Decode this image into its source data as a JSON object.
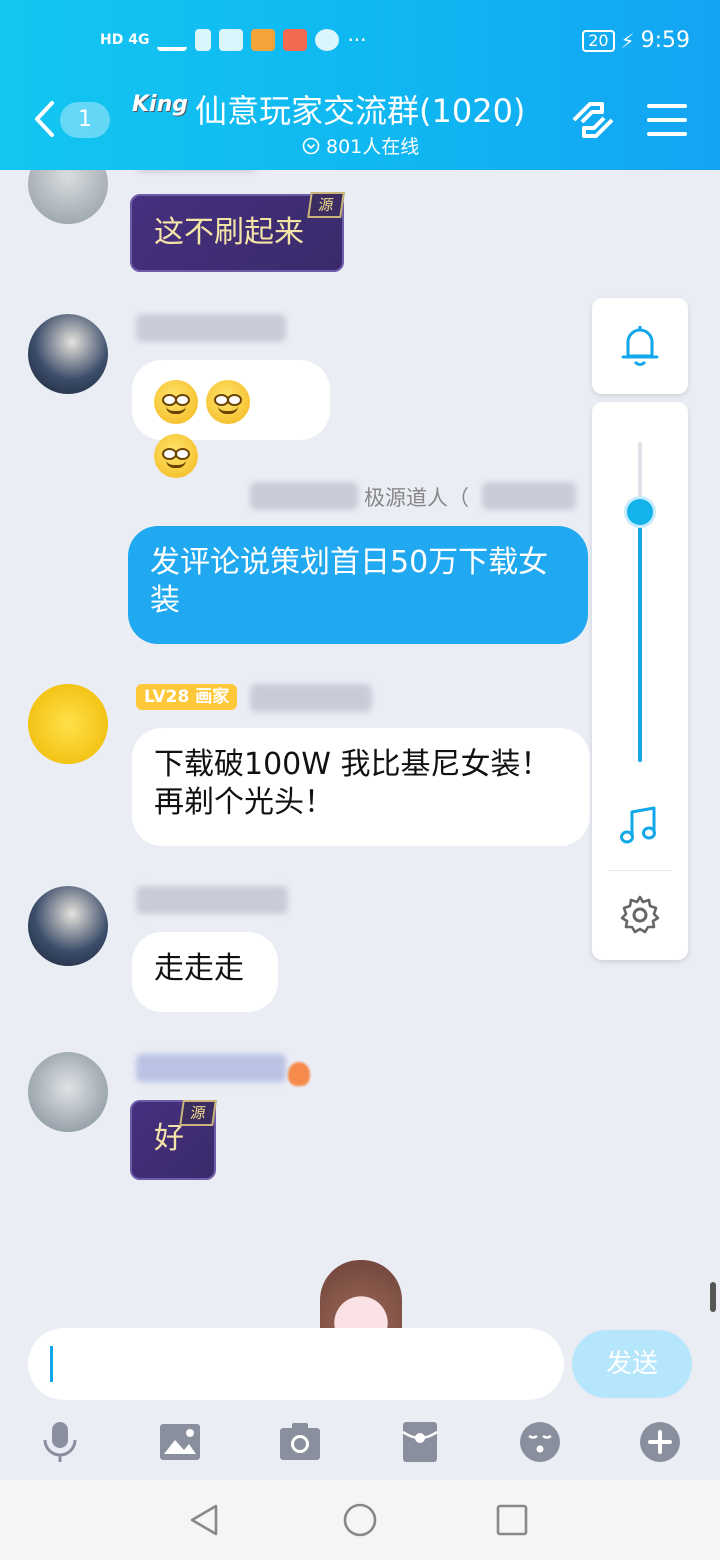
{
  "status_bar": {
    "left": "HD 4G",
    "battery": "20",
    "time": "9:59"
  },
  "header": {
    "unread_count": "1",
    "logo_text": "King",
    "title": "仙意玩家交流群(1020)",
    "online": "801人在线"
  },
  "messages": [
    {
      "text": "这不刷起来",
      "style": "source",
      "tag": "源"
    },
    {
      "emoji_count": 3
    },
    {
      "sender": "极源道人（",
      "text": "发评论说策划首日50万下载女装",
      "self": true
    },
    {
      "level": "LV28 画家",
      "text": "下载破100W 我比基尼女装！再剃个光头！"
    },
    {
      "text": "走走走"
    },
    {
      "text": "好",
      "style": "source",
      "tag": "源"
    }
  ],
  "input": {
    "send_label": "发送"
  },
  "side_panel": {
    "volume_level": 0.78
  },
  "colors": {
    "accent": "#12a7e8",
    "header": "#13c6f1",
    "self_bubble": "#20a9f0"
  }
}
